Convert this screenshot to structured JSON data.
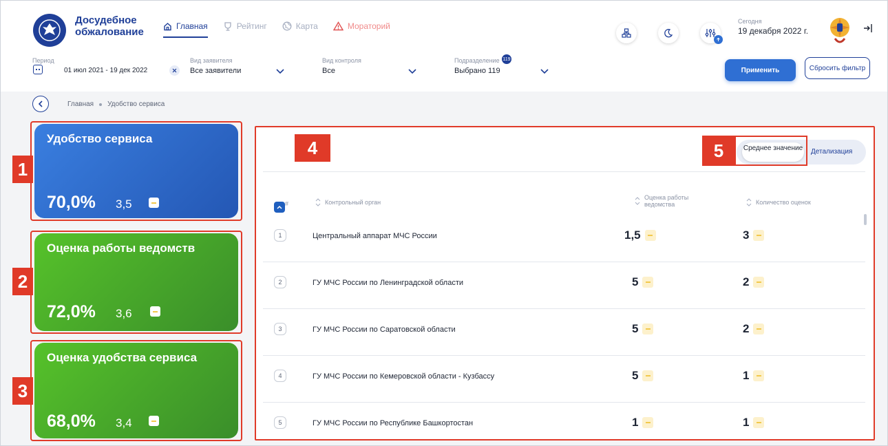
{
  "header": {
    "brand": "Досудебное обжалование",
    "nav": [
      {
        "label": "Главная",
        "icon": "home-icon"
      },
      {
        "label": "Рейтинг",
        "icon": "trophy-icon"
      },
      {
        "label": "Карта",
        "icon": "globe-icon"
      },
      {
        "label": "Мораторий",
        "icon": "warning-icon"
      }
    ],
    "today_label": "Сегодня",
    "today_date": "19 декабря 2022 г.",
    "notification_count": ""
  },
  "filters": {
    "period_label": "Период",
    "period_value": "01 июл 2021  -  19 дек 2022",
    "applicant_label": "Вид заявителя",
    "applicant_value": "Все заявители",
    "control_label": "Вид контроля",
    "control_value": "Все",
    "division_label": "Подразделение",
    "division_badge": "119",
    "division_value": "Выбрано 119",
    "apply_button": "Применить",
    "reset_button": "Сбросить фильтр"
  },
  "breadcrumb": [
    "Главная",
    "Удобство сервиса"
  ],
  "cards": [
    {
      "title": "Удобство сервиса",
      "percent": "70,0%",
      "score": "3,5",
      "tag": "1"
    },
    {
      "title": "Оценка работы ведомств",
      "percent": "72,0%",
      "score": "3,6",
      "tag": "2"
    },
    {
      "title": "Оценка удобства сервиса",
      "percent": "68,0%",
      "score": "3,4",
      "tag": "3"
    }
  ],
  "panel": {
    "tag": "4",
    "toggle_tag": "5",
    "toggle_active": "Среднее значение",
    "toggle_other": "Детализация",
    "columns": [
      "#",
      "Контрольный орган",
      "Оценка работы ведомства",
      "Количество оценок"
    ],
    "rows": [
      {
        "num": "1",
        "name": "Центральный аппарат МЧС России",
        "rating": "1,5",
        "count": "3"
      },
      {
        "num": "2",
        "name": "ГУ МЧС России по Ленинградской области",
        "rating": "5",
        "count": "2"
      },
      {
        "num": "3",
        "name": "ГУ МЧС России по Саратовской области",
        "rating": "5",
        "count": "2"
      },
      {
        "num": "4",
        "name": "ГУ МЧС России по Кемеровской области - Кузбассу",
        "rating": "5",
        "count": "1"
      },
      {
        "num": "5",
        "name": "ГУ МЧС России по Республике Башкортостан",
        "rating": "1",
        "count": "1"
      }
    ]
  },
  "colors": {
    "primary": "#1f3f98",
    "accent_blue": "#2f6fd3",
    "green": "#4fb52a",
    "annotation_red": "#e03a28",
    "warning_yellow": "#f2c94c"
  }
}
